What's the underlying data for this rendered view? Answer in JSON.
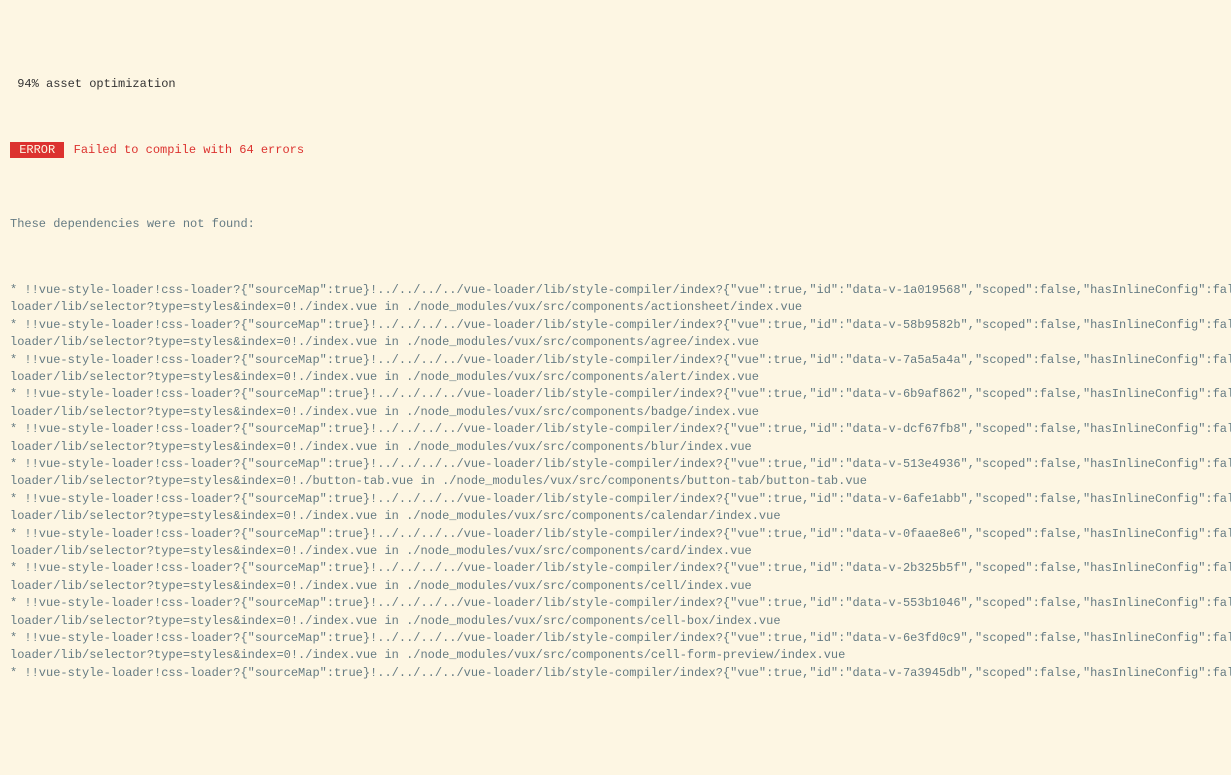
{
  "progress_line": " 94% asset optimization",
  "error_badge": " ERROR ",
  "error_message": " Failed to compile with 64 errors",
  "intro": "These dependencies were not found:",
  "prefix": "* !!vue-style-loader!css-loader?{\"sourceMap\":true}!../../../../vue-loader/lib/style-compiler/index?{\"vue\":true,\"id\":\"",
  "suffix_head": "\",\"scoped\":false,\"hasInlineConfig\":false}!l",
  "second_lead": "loader/lib/selector?type=styles&index=0!./",
  "second_mid": " in ./node_modules/vux/src/components/",
  "deps": [
    {
      "id": "data-v-1a019568",
      "file": "index.vue",
      "path": "actionsheet/index.vue"
    },
    {
      "id": "data-v-58b9582b",
      "file": "index.vue",
      "path": "agree/index.vue"
    },
    {
      "id": "data-v-7a5a5a4a",
      "file": "index.vue",
      "path": "alert/index.vue"
    },
    {
      "id": "data-v-6b9af862",
      "file": "index.vue",
      "path": "badge/index.vue"
    },
    {
      "id": "data-v-dcf67fb8",
      "file": "index.vue",
      "path": "blur/index.vue"
    },
    {
      "id": "data-v-513e4936",
      "file": "button-tab.vue",
      "path": "button-tab/button-tab.vue"
    },
    {
      "id": "data-v-6afe1abb",
      "file": "index.vue",
      "path": "calendar/index.vue"
    },
    {
      "id": "data-v-0faae8e6",
      "file": "index.vue",
      "path": "card/index.vue"
    },
    {
      "id": "data-v-2b325b5f",
      "file": "index.vue",
      "path": "cell/index.vue"
    },
    {
      "id": "data-v-553b1046",
      "file": "index.vue",
      "path": "cell-box/index.vue"
    },
    {
      "id": "data-v-6e3fd0c9",
      "file": "index.vue",
      "path": "cell-form-preview/index.vue"
    }
  ],
  "tail": {
    "id": "data-v-7a3945db"
  }
}
